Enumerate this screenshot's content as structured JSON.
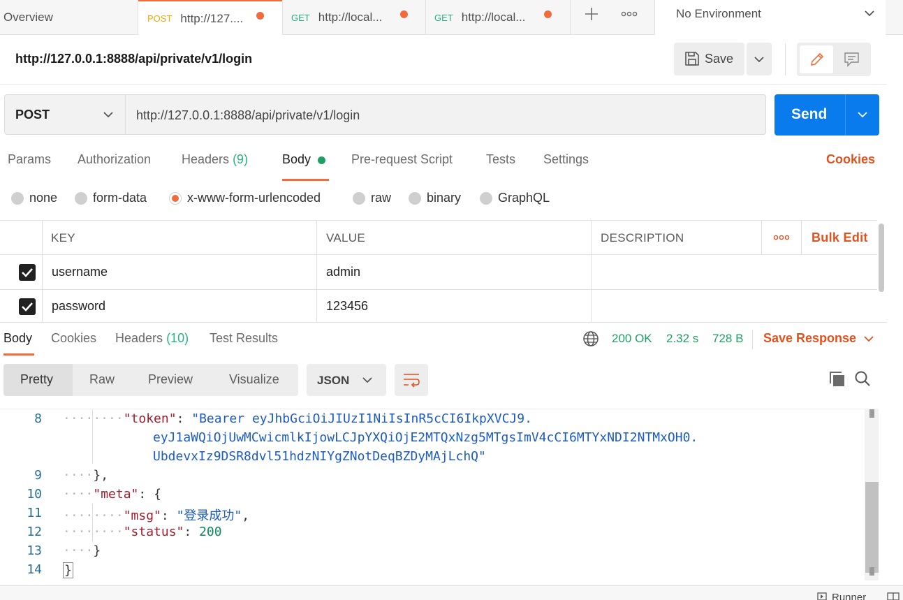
{
  "tabs": {
    "overview": "Overview",
    "items": [
      {
        "method": "POST",
        "title": "http://127....",
        "method_color": "#f2a900"
      },
      {
        "method": "GET",
        "title": "http://local...",
        "method_color": "#26b47f"
      },
      {
        "method": "GET",
        "title": "http://local...",
        "method_color": "#26b47f"
      }
    ],
    "environment": "No Environment"
  },
  "request": {
    "title": "http://127.0.0.1:8888/api/private/v1/login",
    "save_label": "Save",
    "method": "POST",
    "url": "http://127.0.0.1:8888/api/private/v1/login",
    "send_label": "Send"
  },
  "request_tabs": {
    "params": "Params",
    "authorization": "Authorization",
    "headers": "Headers",
    "headers_count": "(9)",
    "body": "Body",
    "prerequest": "Pre-request Script",
    "tests": "Tests",
    "settings": "Settings",
    "cookies": "Cookies"
  },
  "body_types": [
    "none",
    "form-data",
    "x-www-form-urlencoded",
    "raw",
    "binary",
    "GraphQL"
  ],
  "body_type_selected": "x-www-form-urlencoded",
  "params_table": {
    "headers": {
      "key": "KEY",
      "value": "VALUE",
      "description": "DESCRIPTION",
      "bulk_edit": "Bulk Edit"
    },
    "rows": [
      {
        "key": "username",
        "value": "admin",
        "checked": true
      },
      {
        "key": "password",
        "value": "123456",
        "checked": true
      }
    ]
  },
  "response": {
    "tabs": {
      "body": "Body",
      "cookies": "Cookies",
      "headers": "Headers",
      "headers_count": "(10)",
      "tests": "Test Results"
    },
    "status": "200 OK",
    "time": "2.32 s",
    "size": "728 B",
    "save_response": "Save Response",
    "views": {
      "pretty": "Pretty",
      "raw": "Raw",
      "preview": "Preview",
      "visualize": "Visualize"
    },
    "format": "JSON"
  },
  "code": {
    "line_numbers": [
      "8",
      "",
      "",
      "9",
      "10",
      "11",
      "12",
      "13",
      "14"
    ],
    "token_key": "\"token\"",
    "token_value_1": "\"Bearer eyJhbGciOiJIUzI1NiIsInR5cCI6IkpXVCJ9.",
    "token_value_2": "eyJ1aWQiOjUwMCwicmlkIjowLCJpYXQiOjE2MTQxNzg5MTgsImV4cCI6MTYxNDI2NTMxOH0.",
    "token_value_3": "UbdevxIz9DSR8dvl51hdzNIYgZNotDeqBZDyMAjLchQ\"",
    "close_data": "},",
    "meta_key": "\"meta\"",
    "open_brace": "{",
    "msg_key": "\"msg\"",
    "msg_value": "\"登录成功\"",
    "status_key": "\"status\"",
    "status_value": "200",
    "close_meta": "}",
    "close_root": "}"
  },
  "footer": {
    "runner": "Runner"
  },
  "colors": {
    "accent": "#f26b3a",
    "send": "#097bed",
    "success": "#1f9f62",
    "cookies": "#e0531f"
  }
}
